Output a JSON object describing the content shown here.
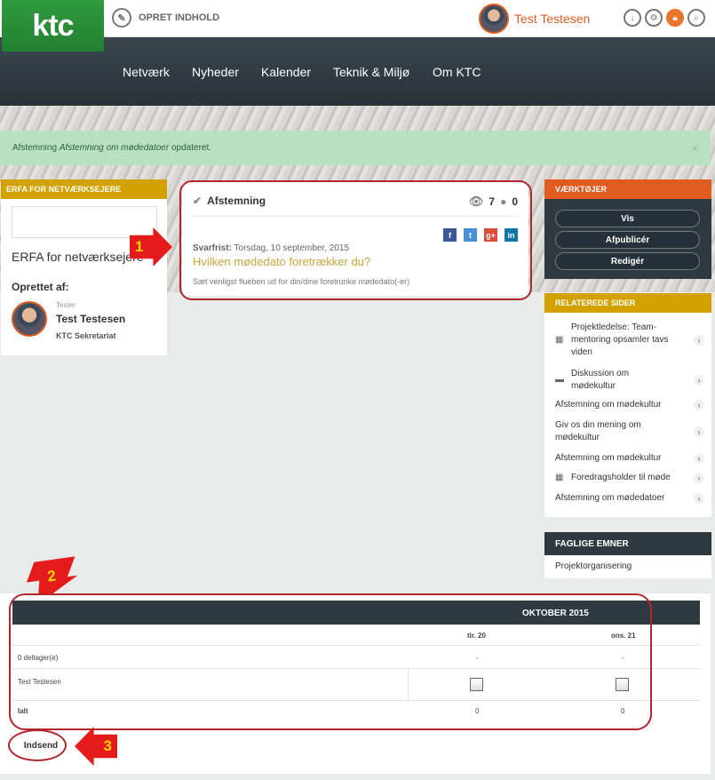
{
  "header": {
    "logo": "ktc",
    "create_label": "OPRET INDHOLD",
    "user_name": "Test Testesen"
  },
  "nav": {
    "items": [
      "Netværk",
      "Nyheder",
      "Kalender",
      "Teknik & Miljø",
      "Om KTC"
    ]
  },
  "alert": {
    "prefix": "Afstemning ",
    "title": "Afstemning om mødedatoer",
    "suffix": " opdateret.",
    "close": "×"
  },
  "erfa": {
    "header": "ERFA FOR NETVÆRKSEJERE",
    "name": "ERFA for netværksejere",
    "created_by": "Oprettet af:",
    "role": "Tester",
    "user": "Test Testesen",
    "org": "KTC Sekretariat"
  },
  "poll": {
    "type": "Afstemning",
    "views": "7",
    "comments": "0",
    "deadline_label": "Svarfrist:",
    "deadline": " Torsdag, 10 september, 2015",
    "question": "Hvilken mødedato foretrækker du?",
    "description": "Sæt venligst flueben ud for din/dine foretrunke mødedato(-er)",
    "social": [
      "f",
      "t",
      "g+",
      "in"
    ]
  },
  "annotations": {
    "a1": "1",
    "a2": "2",
    "a3": "3"
  },
  "tools": {
    "header": "VÆRKTØJER",
    "buttons": [
      "Vis",
      "Afpublicér",
      "Redigér"
    ]
  },
  "related": {
    "header": "RELATEREDE SIDER",
    "items": [
      "Projektledelse: Team-mentoring opsamler tavs viden",
      "Diskussion om mødekultur",
      "Afstemning om mødekultur",
      "Giv os din mening om mødekultur",
      "Afstemning om mødekultur",
      "Foredragsholder til møde",
      "Afstemning om mødedatoer"
    ]
  },
  "faglige": {
    "header": "FAGLIGE EMNER",
    "item": "Projektorganisering"
  },
  "table": {
    "month": "OKTOBER 2015",
    "dates": [
      "tir. 20",
      "ons. 21"
    ],
    "participants": "0 deltager(e)",
    "dash": "-",
    "user": "Test Testesen",
    "total_label": "Ialt",
    "totals": [
      "0",
      "0"
    ]
  },
  "submit": "Indsend",
  "colors": {
    "green": "#2f9a3e",
    "orange": "#e15a1e",
    "gold": "#d3a100",
    "dark": "#2f3a40",
    "annotation_red": "#b3262b"
  }
}
